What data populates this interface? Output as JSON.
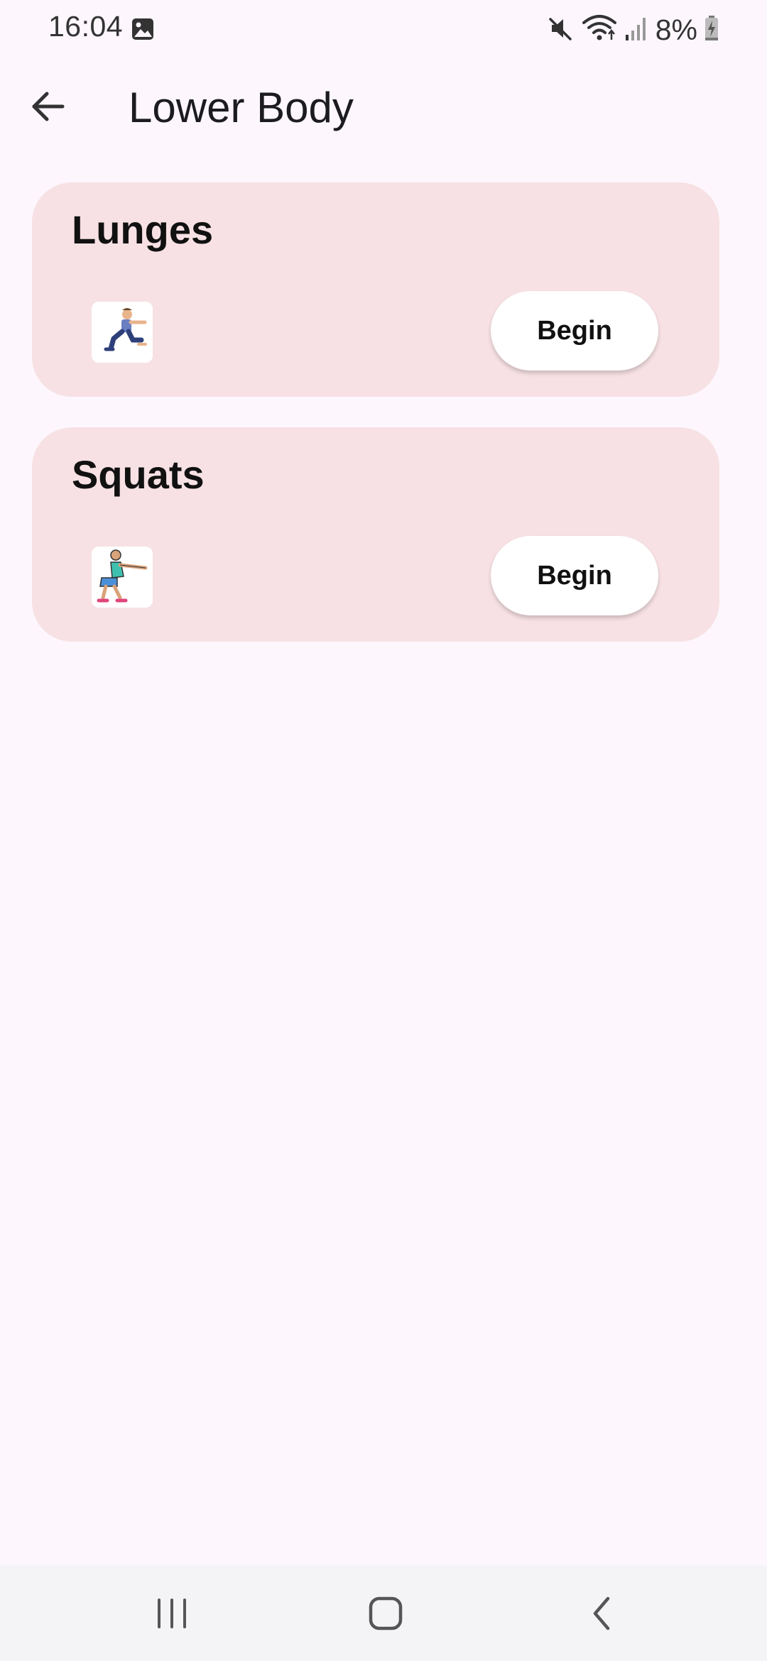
{
  "status_bar": {
    "time": "16:04",
    "battery": "8%"
  },
  "app_bar": {
    "title": "Lower Body"
  },
  "exercises": [
    {
      "name": "Lunges",
      "button_label": "Begin",
      "icon": "lunge-figure-icon"
    },
    {
      "name": "Squats",
      "button_label": "Begin",
      "icon": "squat-figure-icon"
    }
  ],
  "colors": {
    "background": "#fdf7fd",
    "card": "#f7e1e4",
    "button": "#ffffff",
    "nav_bar": "#f4f4f6"
  },
  "icons": {
    "back": "arrow-left-icon",
    "recents": "recents-icon",
    "home": "home-icon",
    "nav_back": "chevron-left-icon"
  }
}
